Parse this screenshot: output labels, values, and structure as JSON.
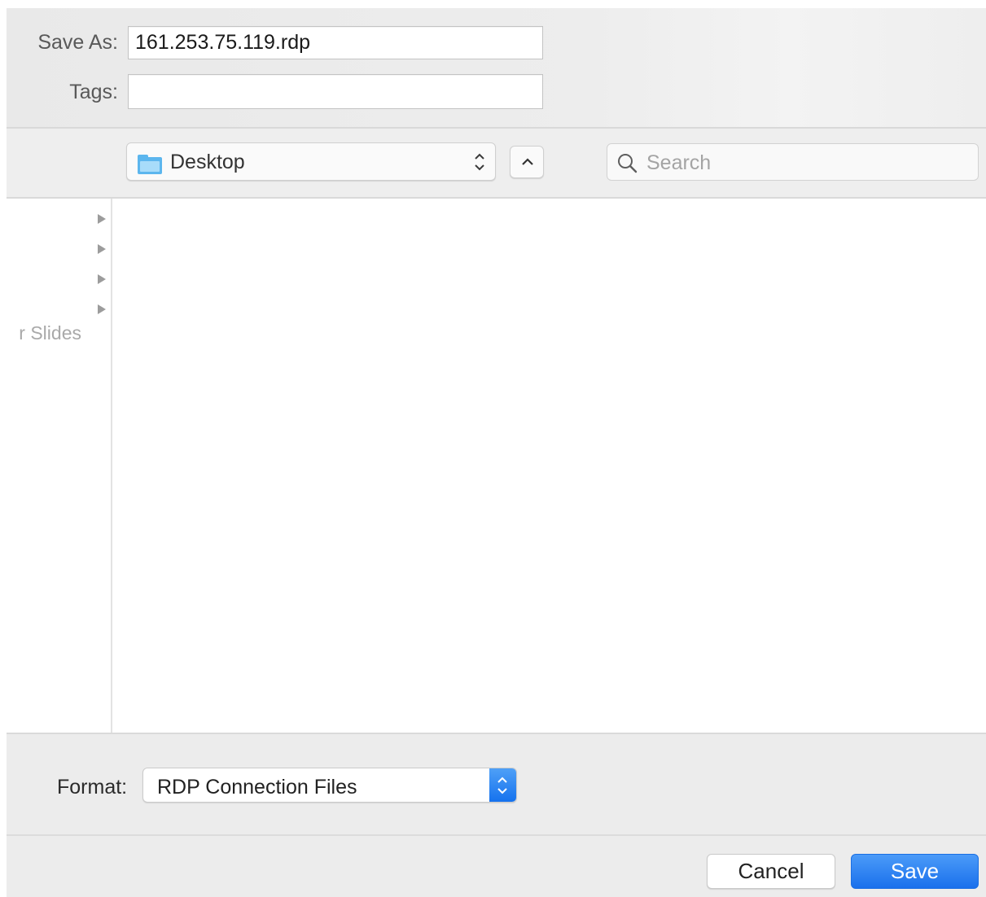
{
  "save_as": {
    "label": "Save As:",
    "value": "161.253.75.119.rdp"
  },
  "tags": {
    "label": "Tags:",
    "value": ""
  },
  "location": {
    "selected": "Desktop",
    "icon": "folder-icon"
  },
  "search": {
    "placeholder": "Search",
    "icon": "search-icon"
  },
  "sidebar": {
    "partial_item_text": "r Slides"
  },
  "format": {
    "label": "Format:",
    "selected": "RDP Connection Files"
  },
  "buttons": {
    "cancel": "Cancel",
    "save": "Save"
  },
  "colors": {
    "accent_blue": "#1a70ec",
    "folder_blue": "#5cb6ee",
    "panel_gray": "#ececec"
  }
}
